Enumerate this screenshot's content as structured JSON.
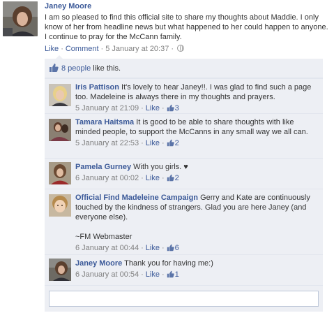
{
  "post": {
    "author": "Janey Moore",
    "text": "I am so pleased to find this official site to share my thoughts about Maddie. I only know of her from headline news but what happened to her could happen to anyone. I continue to pray for the McCann family.",
    "like_label": "Like",
    "comment_label": "Comment",
    "timestamp": "5 January at 20:37",
    "separator": "·"
  },
  "likes": {
    "count_label": "8 people",
    "suffix": " like this."
  },
  "comments": [
    {
      "author": "Iris Pattison",
      "text": "It's lovely to hear Janey!!. I was glad to find such a page too. Madeleine is always there in my thoughts and prayers.",
      "timestamp": "5 January at 21:09",
      "like_label": "Like",
      "likes": "3"
    },
    {
      "author": "Tamara Haitsma",
      "text": "It is good to be able to share thoughts with like minded people, to support the McCanns in any small way we all can.",
      "timestamp": "5 January at 22:53",
      "like_label": "Like",
      "likes": "2"
    },
    {
      "author": "Pamela Gurney",
      "text": "With you girls. ♥",
      "timestamp": "6 January at 00:02",
      "like_label": "Like",
      "likes": "2"
    },
    {
      "author": "Official Find Madeleine Campaign",
      "text": "Gerry and Kate are continuously touched by the kindness of strangers. Glad you are here Janey (and everyone else).",
      "signature": "~FM Webmaster",
      "timestamp": "6 January at 00:44",
      "like_label": "Like",
      "likes": "6"
    },
    {
      "author": "Janey Moore",
      "text": "Thank you for having me:)",
      "timestamp": "6 January at 00:54",
      "like_label": "Like",
      "likes": "1"
    }
  ],
  "reply": {
    "placeholder": ""
  },
  "colors": {
    "link": "#3b5998",
    "ufi_background": "#edeff4",
    "meta_text": "#808080"
  }
}
